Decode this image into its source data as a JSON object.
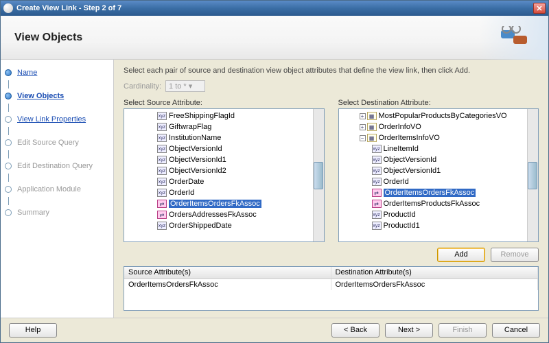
{
  "window": {
    "title": "Create View Link - Step 2 of 7"
  },
  "header": {
    "title": "View Objects"
  },
  "nav": {
    "items": [
      {
        "label": "Name",
        "state": "done"
      },
      {
        "label": "View Objects",
        "state": "current"
      },
      {
        "label": "View Link Properties",
        "state": "enabled"
      },
      {
        "label": "Edit Source Query",
        "state": "disabled"
      },
      {
        "label": "Edit Destination Query",
        "state": "disabled"
      },
      {
        "label": "Application Module",
        "state": "disabled"
      },
      {
        "label": "Summary",
        "state": "disabled"
      }
    ]
  },
  "main": {
    "hint": "Select each pair of source and destination view object attributes that define the view link, then click Add.",
    "cardinality_label": "Cardinality:",
    "cardinality_value": "1 to *",
    "source_label": "Select Source Attribute:",
    "dest_label": "Select Destination Attribute:",
    "source_tree": [
      {
        "label": "FreeShippingFlagId",
        "icon": "xyz"
      },
      {
        "label": "GiftwrapFlag",
        "icon": "xyz"
      },
      {
        "label": "InstitutionName",
        "icon": "xyz"
      },
      {
        "label": "ObjectVersionId",
        "icon": "xyz"
      },
      {
        "label": "ObjectVersionId1",
        "icon": "xyz"
      },
      {
        "label": "ObjectVersionId2",
        "icon": "xyz"
      },
      {
        "label": "OrderDate",
        "icon": "xyz"
      },
      {
        "label": "OrderId",
        "icon": "xyz"
      },
      {
        "label": "OrderItemsOrdersFkAssoc",
        "icon": "assoc",
        "selected": true
      },
      {
        "label": "OrdersAddressesFkAssoc",
        "icon": "assoc"
      },
      {
        "label": "OrderShippedDate",
        "icon": "xyz"
      }
    ],
    "dest_tree": [
      {
        "label": "MostPopularProductsByCategoriesVO",
        "icon": "vo",
        "level": 0,
        "exp": "+"
      },
      {
        "label": "OrderInfoVO",
        "icon": "vo",
        "level": 0,
        "exp": "+"
      },
      {
        "label": "OrderItemsInfoVO",
        "icon": "vo",
        "level": 0,
        "exp": "−"
      },
      {
        "label": "LineItemId",
        "icon": "xyz",
        "level": 1
      },
      {
        "label": "ObjectVersionId",
        "icon": "xyz",
        "level": 1
      },
      {
        "label": "ObjectVersionId1",
        "icon": "xyz",
        "level": 1
      },
      {
        "label": "OrderId",
        "icon": "xyz",
        "level": 1
      },
      {
        "label": "OrderItemsOrdersFkAssoc",
        "icon": "assoc",
        "level": 1,
        "selected": true
      },
      {
        "label": "OrderItemsProductsFkAssoc",
        "icon": "assoc",
        "level": 1
      },
      {
        "label": "ProductId",
        "icon": "xyz",
        "level": 1
      },
      {
        "label": "ProductId1",
        "icon": "xyz",
        "level": 1
      }
    ],
    "add_label": "Add",
    "remove_label": "Remove",
    "mapping": {
      "src_head": "Source Attribute(s)",
      "dst_head": "Destination Attribute(s)",
      "rows": [
        {
          "src": "OrderItemsOrdersFkAssoc",
          "dst": "OrderItemsOrdersFkAssoc"
        }
      ]
    }
  },
  "footer": {
    "help": "Help",
    "back": "< Back",
    "next": "Next >",
    "finish": "Finish",
    "cancel": "Cancel"
  }
}
